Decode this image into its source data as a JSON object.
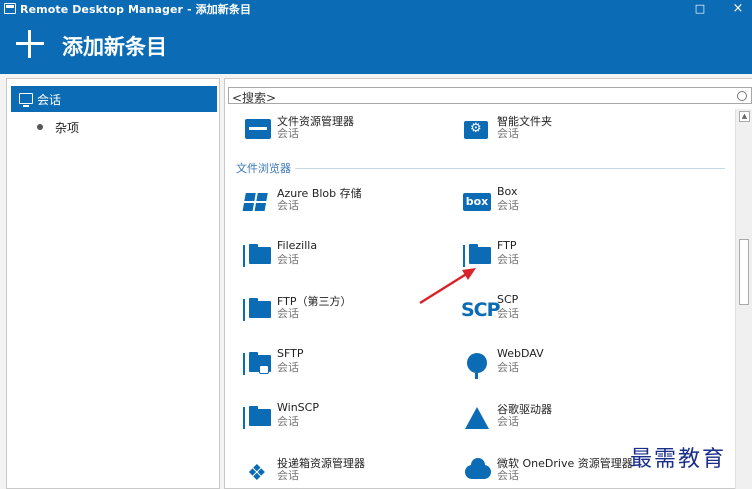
{
  "window": {
    "title": "Remote Desktop Manager - 添加新条目",
    "maximize_glyph": "□",
    "close_glyph": "×"
  },
  "header": {
    "title": "添加新条目"
  },
  "sidebar": {
    "items": [
      {
        "label": "会话",
        "icon": "monitor-icon",
        "active": true
      },
      {
        "label": "杂项",
        "icon": "bullet-icon",
        "active": false
      }
    ]
  },
  "search": {
    "placeholder": "<搜索>"
  },
  "list": {
    "top_entries": [
      {
        "name": "文件资源管理器",
        "sub": "会话",
        "icon": "file-explorer-icon"
      },
      {
        "name": "智能文件夹",
        "sub": "会话",
        "icon": "smart-folder-icon"
      }
    ],
    "section_title": "文件浏览器",
    "entries": [
      {
        "name": "Azure Blob 存储",
        "sub": "会话",
        "icon": "azure-icon"
      },
      {
        "name": "Box",
        "sub": "会话",
        "icon": "box-icon",
        "logo_text": "box"
      },
      {
        "name": "Filezilla",
        "sub": "会话",
        "icon": "filezilla-icon"
      },
      {
        "name": "FTP",
        "sub": "会话",
        "icon": "ftp-icon"
      },
      {
        "name": "FTP（第三方）",
        "sub": "会话",
        "icon": "ftp-third-party-icon"
      },
      {
        "name": "SCP",
        "sub": "会话",
        "icon": "scp-icon",
        "logo_text": "SCP"
      },
      {
        "name": "SFTP",
        "sub": "会话",
        "icon": "sftp-icon"
      },
      {
        "name": "WebDAV",
        "sub": "会话",
        "icon": "webdav-icon"
      },
      {
        "name": "WinSCP",
        "sub": "会话",
        "icon": "winscp-icon"
      },
      {
        "name": "谷歌驱动器",
        "sub": "会话",
        "icon": "google-drive-icon"
      },
      {
        "name": "投递箱资源管理器",
        "sub": "会话",
        "icon": "dropbox-icon"
      },
      {
        "name": "微软 OneDrive 资源管理器",
        "sub": "会话",
        "icon": "onedrive-icon"
      }
    ]
  },
  "watermark": "最需教育",
  "colors": {
    "accent": "#0b6bb5",
    "arrow": "#d9232a",
    "section": "#3a78b8"
  }
}
